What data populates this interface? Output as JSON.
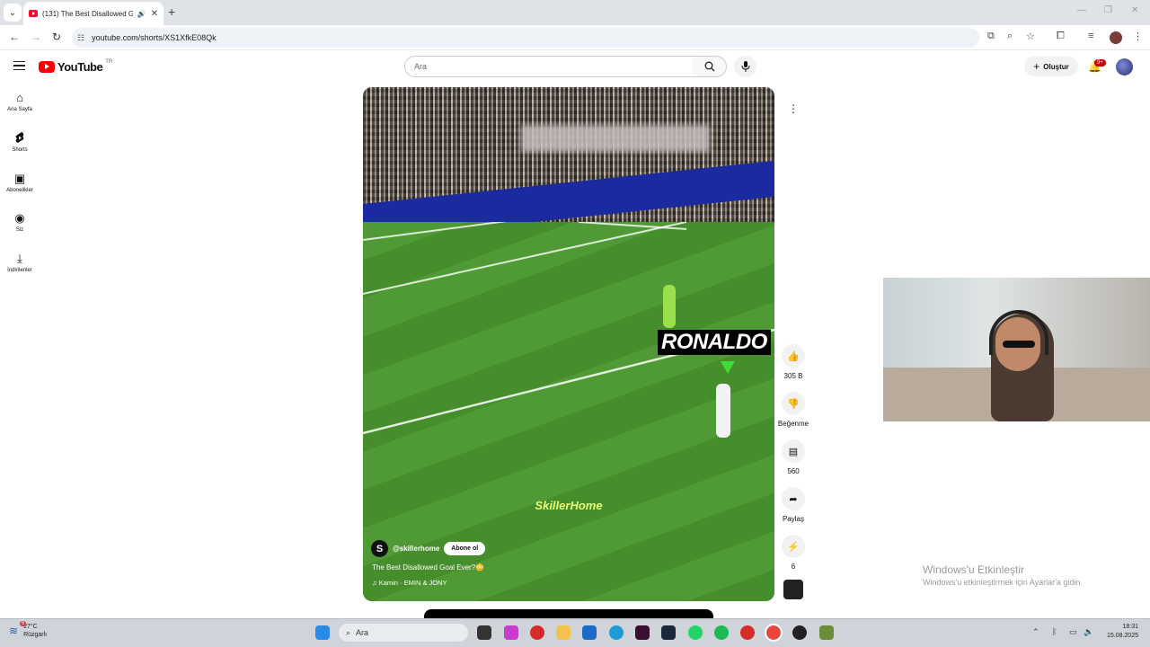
{
  "browser": {
    "tab_title": "(131) The Best Disallowed G",
    "url": "youtube.com/shorts/XS1XfkE08Qk"
  },
  "header": {
    "logo_text": "YouTube",
    "country_code": "TR",
    "search_placeholder": "Ara",
    "create_label": "Oluştur",
    "notification_count": "9+"
  },
  "sidebar": {
    "items": [
      {
        "label": "Ana Sayfa",
        "icon": "home-icon"
      },
      {
        "label": "Shorts",
        "icon": "shorts-icon"
      },
      {
        "label": "Abonelikler",
        "icon": "subscriptions-icon"
      },
      {
        "label": "Siz",
        "icon": "you-icon"
      },
      {
        "label": "İndirilenler",
        "icon": "download-icon"
      }
    ]
  },
  "video": {
    "overlay_name": "RONALDO",
    "watermark": "SkillerHome",
    "channel": "@skillerhome",
    "channel_initial": "S",
    "subscribe_label": "Abone ol",
    "title": "The Best Disallowed Goal Ever?😳",
    "music": "Kamin · EMIN & JONY"
  },
  "actions": {
    "like_count": "305 B",
    "dislike_label": "Beğenme",
    "comment_count": "560",
    "share_label": "Paylaş",
    "remix_count": "6"
  },
  "watermark_os": {
    "line1": "Windows'u Etkinleştir",
    "line2": "Windows'u etkinleştirmek için Ayarlar'a gidin."
  },
  "taskbar": {
    "temperature": "27°C",
    "weather_desc": "Rüzgarlı",
    "weather_badge": "6",
    "search_label": "Ara",
    "time": "18:31",
    "date": "15.08.2025"
  }
}
